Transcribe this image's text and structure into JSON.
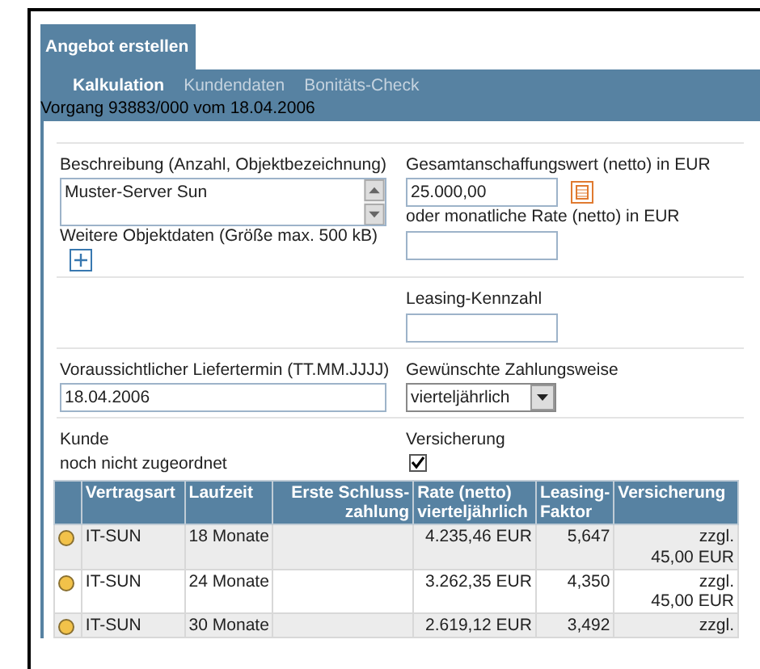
{
  "header_tab": "Angebot erstellen",
  "subtabs": [
    {
      "label": "Kalkulation",
      "selected": true
    },
    {
      "label": "Kundendaten",
      "selected": false
    },
    {
      "label": "Bonitäts-Check",
      "selected": false
    }
  ],
  "process_line": "Vorgang 93883/000 vom 18.04.2006",
  "form": {
    "description": {
      "label": "Beschreibung (Anzahl, Objektbezeichnung)",
      "value": "Muster-Server Sun"
    },
    "more_data": {
      "label": "Weitere Objektdaten (Größe max. 500 kB)"
    },
    "total_value": {
      "label": "Gesamtanschaffungswert (netto) in EUR",
      "value": "25.000,00"
    },
    "monthly_rate": {
      "label": "oder monatliche Rate (netto) in EUR"
    },
    "leasing_ratio": {
      "label": "Leasing-Kennzahl"
    },
    "delivery_date": {
      "label": "Voraussichtlicher Liefertermin (TT.MM.JJJJ)",
      "value": "18.04.2006"
    },
    "payment": {
      "label": "Gewünschte Zahlungsweise",
      "value": "vierteljährlich"
    },
    "customer": {
      "label": "Kunde",
      "value": "noch nicht zugeordnet"
    },
    "insurance": {
      "label": "Versicherung",
      "checked": true
    }
  },
  "table": {
    "columns": [
      "Vertragsart",
      "Laufzeit",
      "Erste Schluss-zahlung",
      "Rate (netto) vierteljährlich",
      "Leasing-Faktor",
      "Versicherung"
    ],
    "rows": [
      {
        "cells": [
          "IT-SUN",
          "18 Monate",
          "",
          "4.235,46 EUR",
          "5,647",
          "zzgl.",
          "45,00 EUR"
        ]
      },
      {
        "cells": [
          "IT-SUN",
          "24 Monate",
          "",
          "3.262,35 EUR",
          "4,350",
          "zzgl.",
          "45,00 EUR"
        ]
      },
      {
        "cells": [
          "IT-SUN",
          "30 Monate",
          "",
          "2.619,12 EUR",
          "3,492",
          "zzgl."
        ]
      }
    ]
  }
}
